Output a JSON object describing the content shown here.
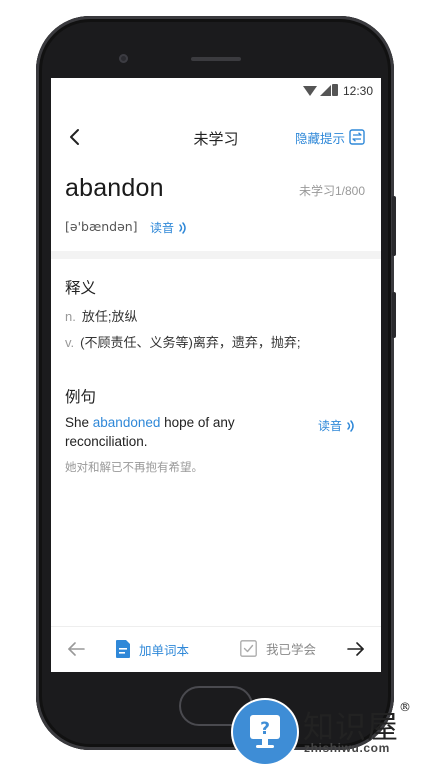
{
  "status_bar": {
    "time": "12:30"
  },
  "header": {
    "title": "未学习",
    "hide_hint_label": "隐藏提示"
  },
  "word": {
    "text": "abandon",
    "progress": "未学习1/800",
    "phonetic": "[ə'bændən]",
    "read_label": "读音"
  },
  "definitions": {
    "title": "释义",
    "items": [
      {
        "pos": "n.",
        "meaning": "放任;放纵"
      },
      {
        "pos": "v.",
        "meaning": "(不顾责任、义务等)离弃，遗弃，抛弃;"
      }
    ]
  },
  "examples": {
    "title": "例句",
    "sentence_before": "She ",
    "sentence_highlight": "abandoned",
    "sentence_after": " hope of any reconciliation.",
    "read_label": "读音",
    "translation": "她对和解已不再抱有希望。"
  },
  "bottom_bar": {
    "add_vocab_label": "加单词本",
    "learned_label": "我已学会"
  },
  "watermark": {
    "brand": "知识屋",
    "reg": "®",
    "url": "zhishiwu.com"
  },
  "colors": {
    "accent": "#2f88d8",
    "muted": "#999999",
    "watermark_blue": "#3e8dd6"
  }
}
